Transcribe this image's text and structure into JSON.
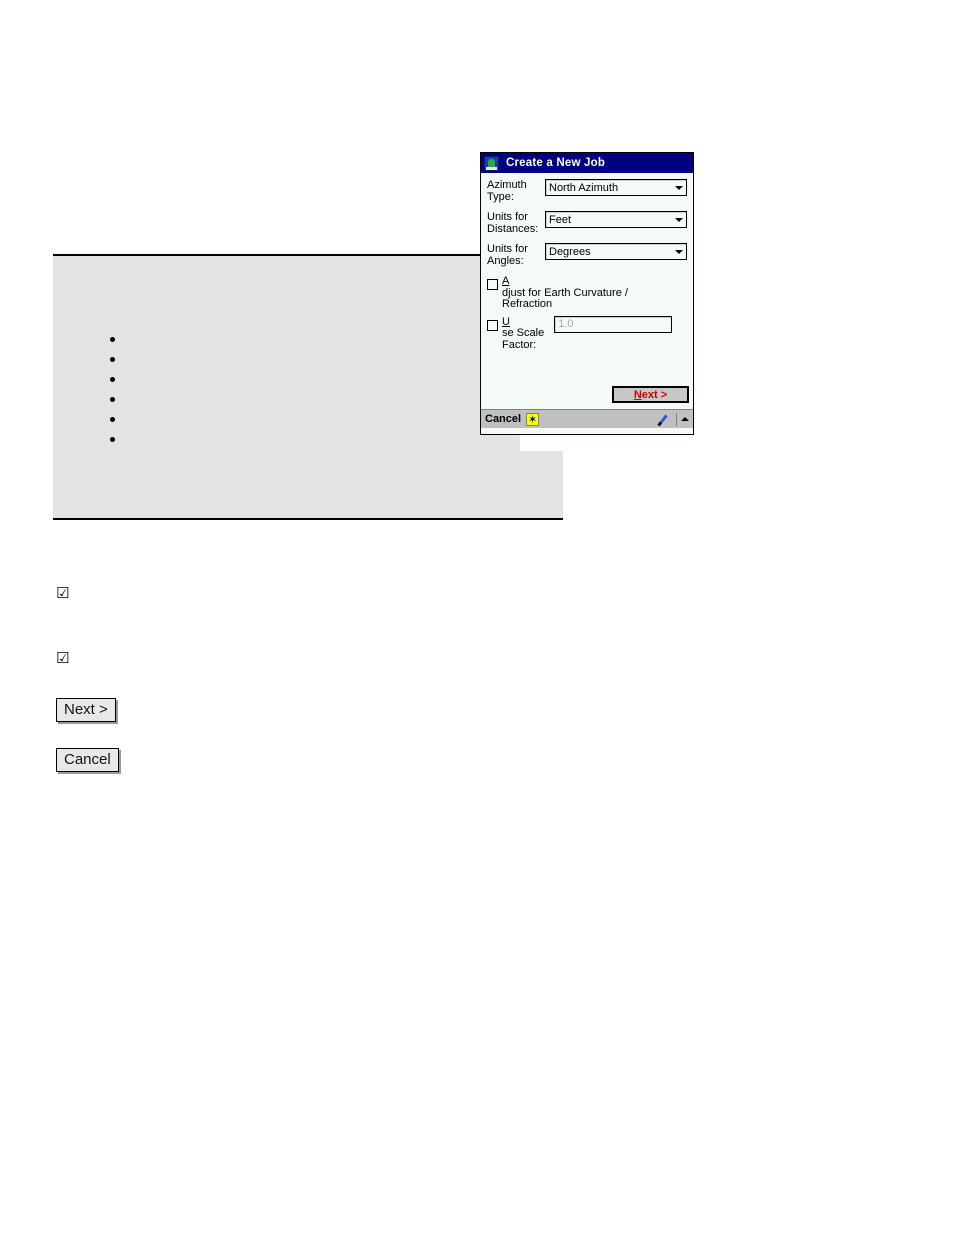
{
  "document": {
    "bullets": [
      "",
      "",
      "",
      "",
      "",
      ""
    ],
    "checkmark_glyph": "☑",
    "inline_buttons": {
      "next": "Next >",
      "cancel": "Cancel"
    }
  },
  "dialog": {
    "title": "Create a New Job",
    "title_icon": "job-app-icon",
    "fields": [
      {
        "label_line1": "Azimuth",
        "label_line2": "Type:",
        "value": "North Azimuth",
        "name": "azimuth-type"
      },
      {
        "label_line1": "Units for",
        "label_line2": "Distances:",
        "value": "Feet",
        "name": "units-distances"
      },
      {
        "label_line1": "Units for",
        "label_line2": "Angles:",
        "value": "Degrees",
        "name": "units-angles"
      }
    ],
    "checkboxes": [
      {
        "accel": "A",
        "line1_rest": "djust for Earth Curvature /",
        "line2": "Refraction",
        "checked": false
      },
      {
        "accel": "U",
        "line1_rest": "se Scale",
        "line2": "Factor:",
        "checked": false
      }
    ],
    "scale_factor_value": "1.0",
    "next_button": {
      "accel": "N",
      "rest": "ext >"
    },
    "taskbar": {
      "cancel_label": "Cancel",
      "star_glyph": "✶",
      "pen_icon": "stylus-pen-icon",
      "up_arrow_icon": "chevron-up-icon"
    }
  },
  "colors": {
    "titlebar": "#000080",
    "dialog_body": "#f4faf6",
    "taskbar": "#c0c0c0",
    "accent_red": "#cc0000",
    "doc_box_fill": "#e4e4e4",
    "star_yellow": "#ffff00"
  }
}
